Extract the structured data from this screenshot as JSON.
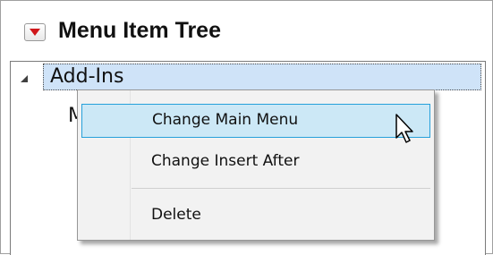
{
  "header": {
    "title": "Menu Item Tree",
    "collapse_icon": "red-triangle-down-icon"
  },
  "tree": {
    "root": {
      "label": "Add-Ins",
      "expanded": true,
      "expand_icon": "triangle-expanded-icon"
    },
    "child": {
      "label": "M"
    }
  },
  "context_menu": {
    "items": [
      {
        "label": "Change Main Menu",
        "hovered": true
      },
      {
        "label": "Change Insert After",
        "hovered": false
      },
      {
        "label": "Delete",
        "hovered": false
      }
    ]
  },
  "cursor_icon": "arrow-pointer-icon",
  "colors": {
    "accent_red": "#d0171b",
    "selection_bg": "#cfe3f8",
    "menu_hover_bg": "#cce8f6",
    "menu_hover_border": "#26a0da",
    "menu_bg": "#f2f2f2"
  }
}
